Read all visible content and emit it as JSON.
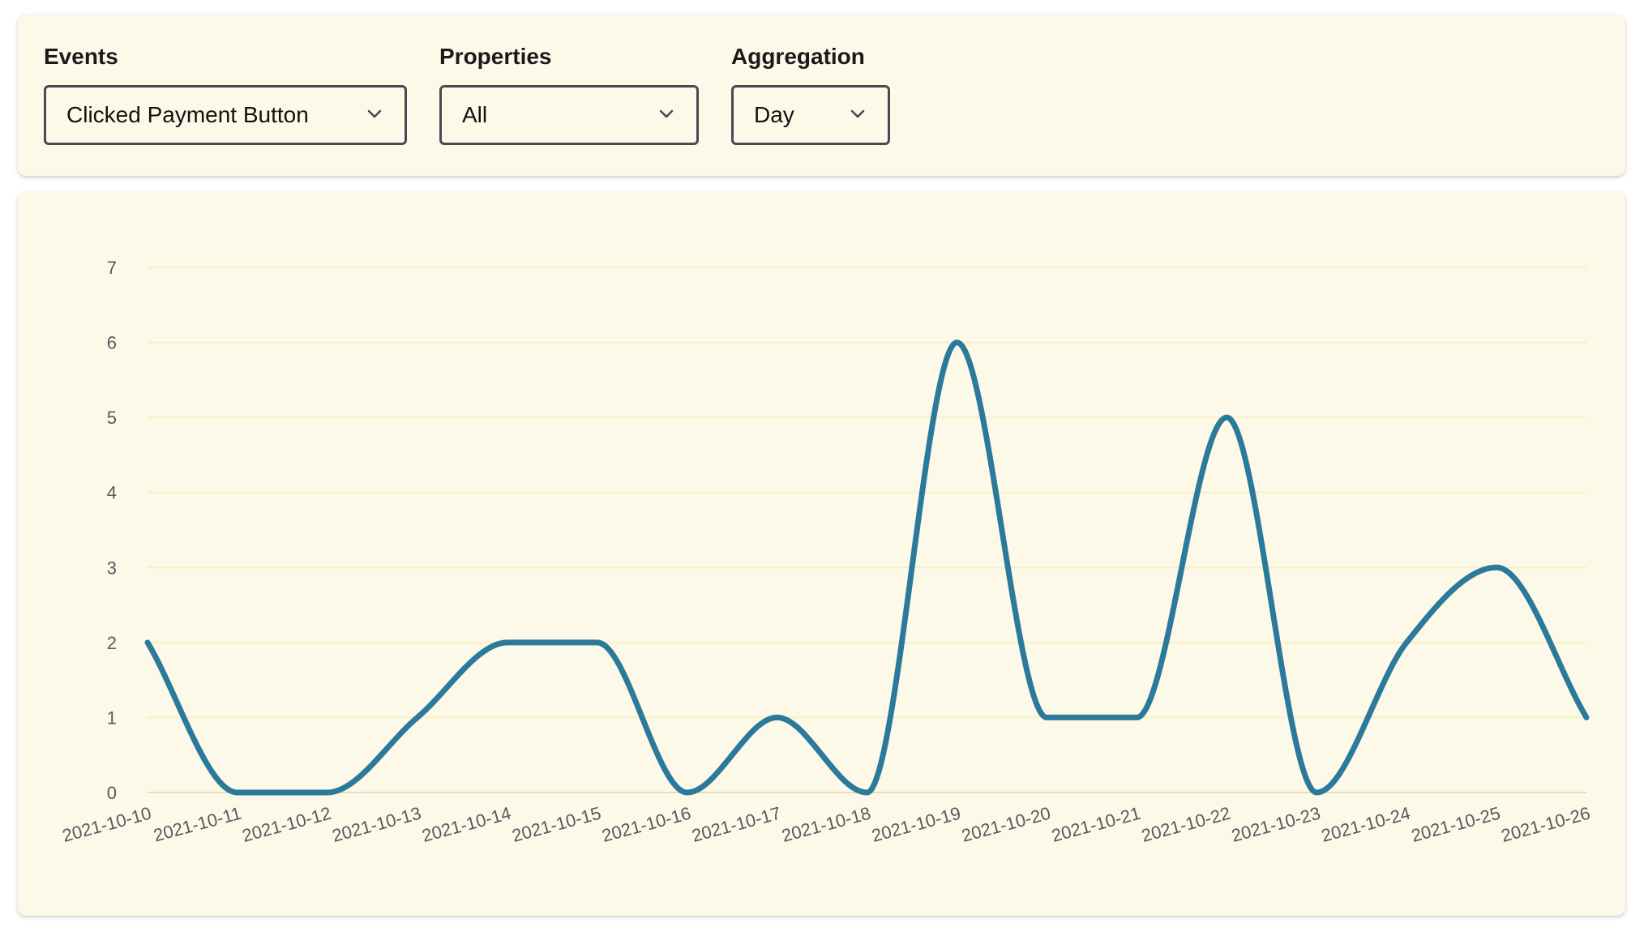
{
  "filters": {
    "events": {
      "label": "Events",
      "value": "Clicked Payment Button"
    },
    "properties": {
      "label": "Properties",
      "value": "All"
    },
    "aggregation": {
      "label": "Aggregation",
      "value": "Day"
    }
  },
  "icons": {
    "dropdown": "chevron-down-icon"
  },
  "colors": {
    "card_background": "#fdf9e8",
    "line": "#2b7a9b",
    "gridline": "#f7efc4",
    "baseline": "#e3dcc0",
    "select_border": "#454b54"
  },
  "chart_data": {
    "type": "line",
    "x": [
      "2021-10-10",
      "2021-10-11",
      "2021-10-12",
      "2021-10-13",
      "2021-10-14",
      "2021-10-15",
      "2021-10-16",
      "2021-10-17",
      "2021-10-18",
      "2021-10-19",
      "2021-10-20",
      "2021-10-21",
      "2021-10-22",
      "2021-10-23",
      "2021-10-24",
      "2021-10-25",
      "2021-10-26"
    ],
    "series": [
      {
        "values": [
          2,
          0,
          0,
          1,
          2,
          2,
          0,
          1,
          0,
          6,
          1,
          1,
          5,
          0,
          2,
          3,
          1
        ]
      }
    ],
    "y_ticks": [
      0,
      1,
      2,
      3,
      4,
      5,
      6,
      7
    ],
    "ylim": [
      0,
      7
    ],
    "title": "",
    "xlabel": "",
    "ylabel": "",
    "grid": true,
    "legend": "none",
    "curve": "smooth"
  }
}
